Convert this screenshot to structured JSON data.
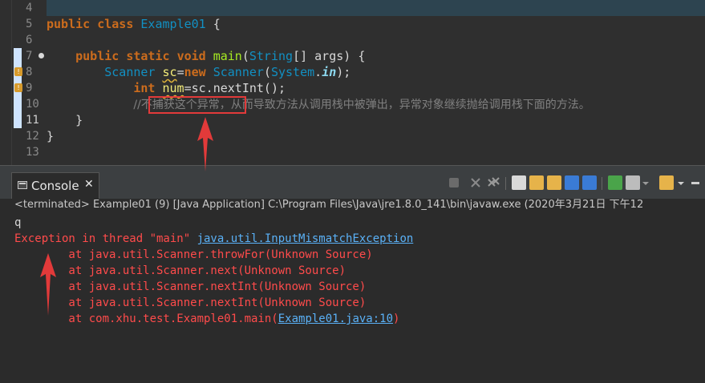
{
  "editor": {
    "lines": [
      {
        "num": "4"
      },
      {
        "num": "5"
      },
      {
        "num": "6"
      },
      {
        "num": "7"
      },
      {
        "num": "8"
      },
      {
        "num": "9"
      },
      {
        "num": "10"
      },
      {
        "num": "11"
      },
      {
        "num": "12"
      },
      {
        "num": "13"
      }
    ],
    "code": {
      "l5_kw1": "public",
      "l5_kw2": "class",
      "l5_cls": "Example01",
      "l5_rest": " {",
      "l7_kw1": "public",
      "l7_kw2": "static",
      "l7_kw3": "void",
      "l7_meth": "main",
      "l7_p1": "(",
      "l7_cls": "String",
      "l7_p2": "[] args) {",
      "l8_cls1": "Scanner",
      "l8_var": "sc",
      "l8_eq": "=",
      "l8_kw": "new",
      "l8_cls2": "Scanner",
      "l8_p1": "(",
      "l8_cls3": "System",
      "l8_dot": ".",
      "l8_field": "in",
      "l8_p2": ");",
      "l9_kw": "int",
      "l9_var": "num",
      "l9_rest": "=sc.nextInt();",
      "l10_comment": "//不捕获这个异常，从而导致方法从调用栈中被弹出，异常对象继续抛给调用栈下面的方法。",
      "l11": "}",
      "l12": "}"
    }
  },
  "console": {
    "tab_label": "Console",
    "tab_close": "✕",
    "terminated": "<terminated> Example01 (9) [Java Application] C:\\Program Files\\Java\\jre1.8.0_141\\bin\\javaw.exe (2020年3月21日 下午12",
    "input_echo": "q",
    "exception_prefix": "Exception in thread \"main\" ",
    "exception_link": "java.util.InputMismatchException",
    "stack": [
      "        at java.util.Scanner.throwFor(Unknown Source)",
      "        at java.util.Scanner.next(Unknown Source)",
      "        at java.util.Scanner.nextInt(Unknown Source)",
      "        at java.util.Scanner.nextInt(Unknown Source)"
    ],
    "last_prefix": "        at com.xhu.test.Example01.main(",
    "last_link": "Example01.java:10",
    "last_suffix": ")"
  },
  "colors": {
    "keyword": "#cc6c1d",
    "class": "#1290c3",
    "method": "#a7ec21",
    "error": "#ff4b4b",
    "link": "#5ab1f7",
    "annotation": "#e23a3a"
  }
}
